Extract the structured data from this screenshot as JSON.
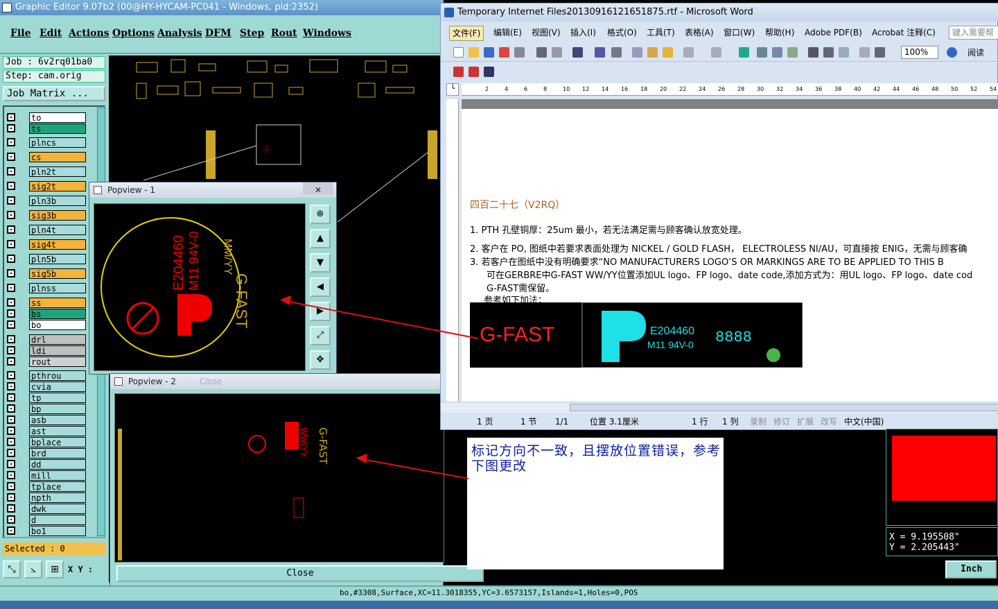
{
  "graphic_editor": {
    "title": "Graphic Editor 9.07b2 (00@HY-HYCAM-PC041 - Windows, pid:2352)",
    "menus": [
      "File",
      "Edit",
      "Actions",
      "Options",
      "Analysis",
      "DFM",
      "Step",
      "Rout",
      "Windows"
    ],
    "job": "Job : 6v2rq01ba0",
    "step": "Step: cam.orig",
    "job_matrix": "Job Matrix ...",
    "layers": [
      {
        "name": "to",
        "color": "#ffffff"
      },
      {
        "name": "ts",
        "color": "#1ea37a"
      },
      {
        "name": "plncs",
        "color": "#a8dcdc"
      },
      {
        "name": "cs",
        "color": "#f4b43c"
      },
      {
        "name": "pln2t",
        "color": "#a8dcdc"
      },
      {
        "name": "sig2t",
        "color": "#f4b43c"
      },
      {
        "name": "pln3b",
        "color": "#a8dcdc"
      },
      {
        "name": "sig3b",
        "color": "#f4b43c"
      },
      {
        "name": "pln4t",
        "color": "#a8dcdc"
      },
      {
        "name": "sig4t",
        "color": "#f4b43c"
      },
      {
        "name": "pln5b",
        "color": "#a8dcdc"
      },
      {
        "name": "sig5b",
        "color": "#f4b43c"
      },
      {
        "name": "plnss",
        "color": "#a8dcdc"
      },
      {
        "name": "ss",
        "color": "#f4b43c"
      },
      {
        "name": "bs",
        "color": "#1ea37a"
      },
      {
        "name": "bo",
        "color": "#ffffff"
      },
      {
        "name": "drl",
        "color": "#c0c0c0"
      },
      {
        "name": "ldi",
        "color": "#c0c0c0"
      },
      {
        "name": "rout",
        "color": "#d0d0d0"
      },
      {
        "name": "pthrou",
        "color": "#a8dcdc"
      },
      {
        "name": "cvia",
        "color": "#a8dcdc"
      },
      {
        "name": "tp",
        "color": "#a8dcdc"
      },
      {
        "name": "bp",
        "color": "#a8dcdc"
      },
      {
        "name": "asb",
        "color": "#a8dcdc"
      },
      {
        "name": "ast",
        "color": "#a8dcdc"
      },
      {
        "name": "bplace",
        "color": "#a8dcdc"
      },
      {
        "name": "brd",
        "color": "#a8dcdc"
      },
      {
        "name": "dd",
        "color": "#a8dcdc"
      },
      {
        "name": "mill",
        "color": "#a8dcdc"
      },
      {
        "name": "tplace",
        "color": "#a8dcdc"
      },
      {
        "name": "npth",
        "color": "#a8dcdc"
      },
      {
        "name": "dwk",
        "color": "#a8dcdc"
      },
      {
        "name": "d",
        "color": "#a8dcdc"
      },
      {
        "name": "bo1",
        "color": "#a8dcdc"
      }
    ],
    "selected": "Selected : 0",
    "xy_label": "X Y :",
    "status": "bo,#3308,Surface,XC=11.3018355,YC=3.6573157,Islands=1,Holes=0,POS",
    "popview1_title": "Popview - 1",
    "popview2_title": "Popview - 2",
    "popview2_close_ghost": "Close",
    "close_label": "Close",
    "coord_x": "X  =  9.195508\"",
    "coord_y": "Y  =  2.205443\"",
    "unit": "Inch"
  },
  "artwork": {
    "ul_number": "E204460",
    "material": "M11 94V-0",
    "logo_word": "G-FAST",
    "week_year": "MM/YY",
    "ww_yy": "WW/YY",
    "date_stamp": "8888"
  },
  "word": {
    "title": "Temporary Internet Files20130916121651875.rtf - Microsoft Word",
    "menus": [
      "文件(F)",
      "编辑(E)",
      "视图(V)",
      "插入(I)",
      "格式(O)",
      "工具(T)",
      "表格(A)",
      "窗口(W)",
      "帮助(H)",
      "Adobe PDF(B)",
      "Acrobat 注释(C)"
    ],
    "help_placeholder": "键入需要帮助",
    "zoom": "100%",
    "reading": "阅读",
    "ruler_marks": [
      "2",
      "4",
      "6",
      "8",
      "10",
      "12",
      "14",
      "16",
      "18",
      "20",
      "22",
      "24",
      "26",
      "28",
      "30",
      "32",
      "34",
      "36",
      "38",
      "40",
      "42",
      "44",
      "46",
      "48",
      "50",
      "52",
      "54"
    ],
    "heading": "四百二十七（V2RQ）",
    "items": [
      "1.   PTH 孔壁铜厚：25um 最小，若无法满足需与顾客确认放宽处理。",
      "2.   客户在 PO, 图纸中若要求表面处理为 NICKEL / GOLD FLASH， ELECTROLESS NI/AU，可直接按 ENIG，无需与顾客确",
      "3.   若客户在图纸中没有明确要求“NO MANUFACTURERS LOGO’S OR MARKINGS ARE TO BE APPLIED TO THIS B"
    ],
    "item3_cont1": "可在GERBRE中G-FAST WW/YY位置添加UL logo、FP logo、date code,添加方式为：用UL logo、FP logo、date cod",
    "item3_cont2": "G-FAST需保留。",
    "ref_line": "参考如下加法：",
    "status": {
      "page": "1 页",
      "section": "1 节",
      "pages": "1/1",
      "pos": "位置 3.1厘米",
      "line": "1 行",
      "col": "1 列",
      "rec": "录制",
      "trk": "修订",
      "ext": "扩展",
      "ovr": "改写",
      "lang": "中文(中国)"
    }
  },
  "note": "标记方向不一致，且摆放位置错误，参考下图更改"
}
